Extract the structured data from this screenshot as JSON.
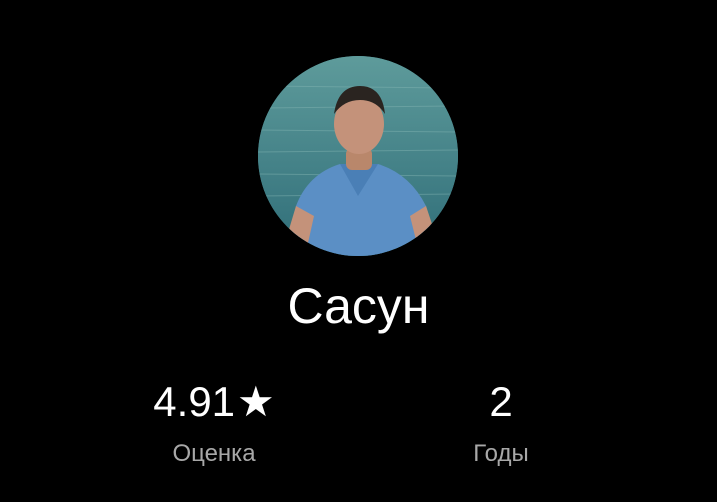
{
  "profile": {
    "name": "Сасун"
  },
  "stats": {
    "rating": {
      "value": "4.91",
      "icon": "star-icon",
      "star_glyph": "★",
      "label": "Оценка"
    },
    "years": {
      "value": "2",
      "label": "Годы"
    }
  },
  "colors": {
    "background": "#000000",
    "primary_text": "#ffffff",
    "secondary_text": "#a8a8a8"
  }
}
